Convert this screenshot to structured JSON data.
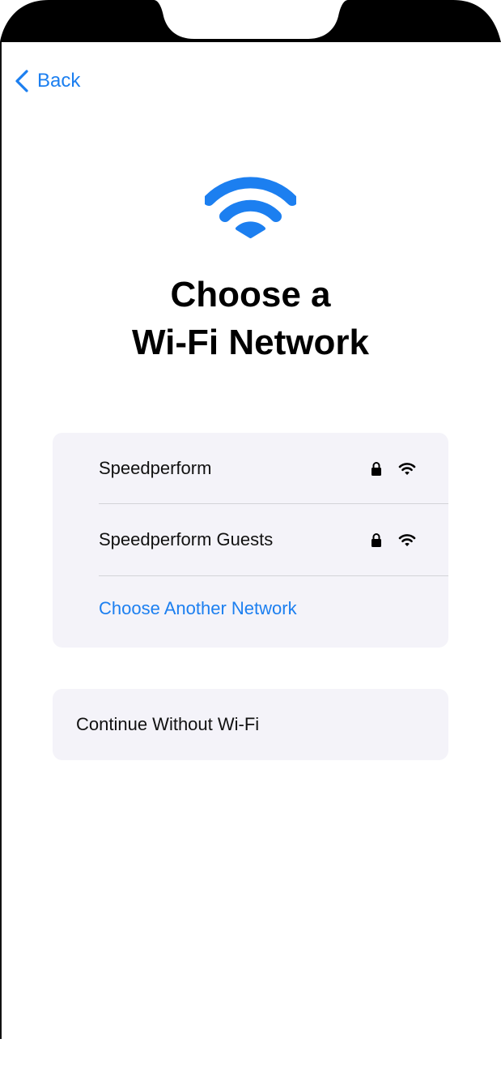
{
  "nav": {
    "back_label": "Back"
  },
  "header": {
    "title_line1": "Choose a",
    "title_line2": "Wi-Fi Network",
    "hero_icon": "wifi-icon"
  },
  "networks": {
    "items": [
      {
        "name": "Speedperform",
        "secured": true,
        "icons": [
          "lock-icon",
          "wifi-signal-icon"
        ]
      },
      {
        "name": "Speedperform Guests",
        "secured": true,
        "icons": [
          "lock-icon",
          "wifi-signal-icon"
        ]
      }
    ],
    "other_label": "Choose Another Network"
  },
  "continue_without_label": "Continue Without Wi-Fi",
  "colors": {
    "accent": "#1c7ff0",
    "card_bg": "#f4f3f9",
    "text": "#111111"
  }
}
